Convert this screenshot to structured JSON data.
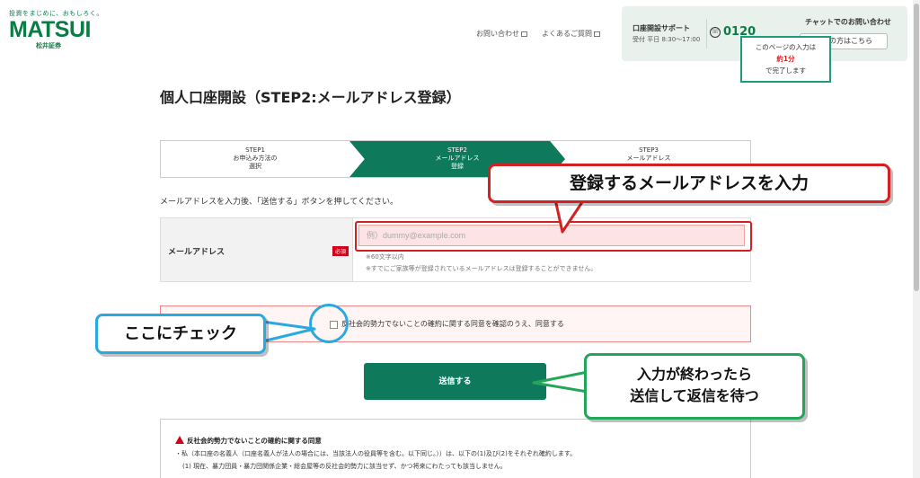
{
  "header": {
    "logo_tagline": "投資をまじめに、おもしろく。",
    "logo_name": "MATSUI",
    "logo_subname": "松井証券",
    "contact_link": "お問い合わせ",
    "faq_link": "よくあるご質問",
    "support_title": "口座開設サポート",
    "support_hours": "受付 平日 8:30～17:00",
    "phone_number": "0120",
    "chat_label": "チャットでのお問い合わせ",
    "chat_button": "初めの方はこちら"
  },
  "time_tip": {
    "line1": "このページの入力は",
    "line2": "約1分",
    "line3": "で完了します"
  },
  "page_title": "個人口座開設（STEP2:メールアドレス登録）",
  "steps": [
    {
      "label": "STEP1",
      "desc1": "お申込み方法の",
      "desc2": "選択"
    },
    {
      "label": "STEP2",
      "desc1": "メールアドレス",
      "desc2": "登録"
    },
    {
      "label": "STEP3",
      "desc1": "メールアドレス",
      "desc2": ""
    }
  ],
  "instruction": "メールアドレスを入力後、「送信する」ボタンを押してください。",
  "email": {
    "label": "メールアドレス",
    "required": "必須",
    "placeholder": "例）dummy@example.com",
    "hint1": "※60文字以内",
    "hint2": "※すでにご家族等が登録されているメールアドレスは登録することができません。"
  },
  "consent": {
    "text": "反社会的勢力でないことの確約に関する同意を確認のうえ、同意する"
  },
  "submit_label": "送信する",
  "notice": {
    "title": "反社会的勢力でないことの確約に関する同意",
    "line1": "・私（本口座の名義人（口座名義人が法人の場合には、当該法人の役員等を含む。以下同じ。））は、以下の(1)及び(2)をそれぞれ確約します。",
    "line2": "(1) 現在、暴力団員・暴力団関係企業・総会屋等の反社会的勢力に該当せず、かつ将来にわたっても該当しません。"
  },
  "annotations": {
    "email_callout": "登録するメールアドレスを入力",
    "check_callout": "ここにチェック",
    "submit_callout_line1": "入力が終わったら",
    "submit_callout_line2": "送信して返信を待つ"
  },
  "colors": {
    "brand_green": "#0a7d45",
    "step_active": "#0f7a5b",
    "required_red": "#d0021b",
    "callout_red": "#d42020",
    "callout_blue": "#2aa9e0",
    "callout_green": "#24a65a"
  }
}
